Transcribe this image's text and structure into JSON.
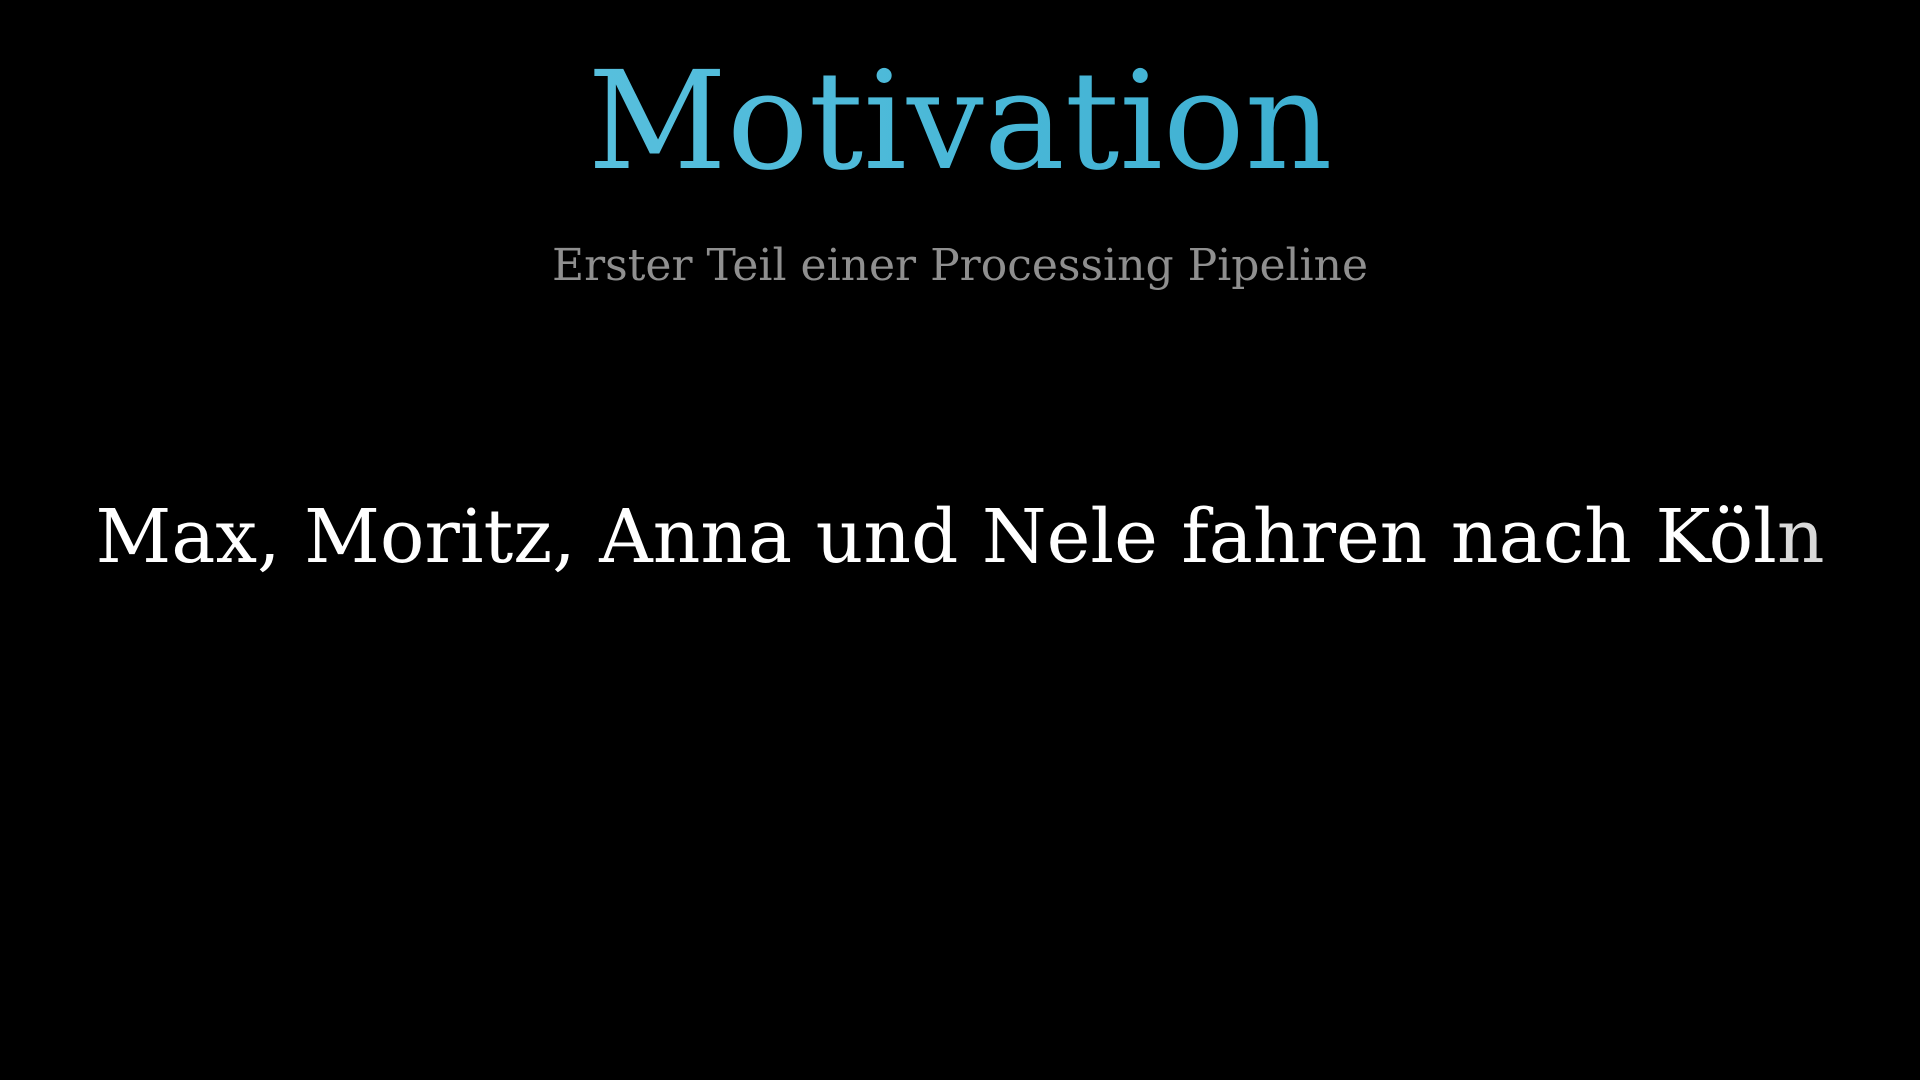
{
  "slide": {
    "title": "Motivation",
    "subtitle": "Erster Teil einer Processing Pipeline",
    "sentence_main": "Max, Moritz, Anna und Nele fahren nach Köl",
    "sentence_tail": "n"
  },
  "colors": {
    "background": "#000000",
    "title_gradient_start": "#6ccbe5",
    "title_gradient_end": "#2aa3c8",
    "subtitle": "#8f8f8f",
    "sentence": "#ffffff"
  }
}
